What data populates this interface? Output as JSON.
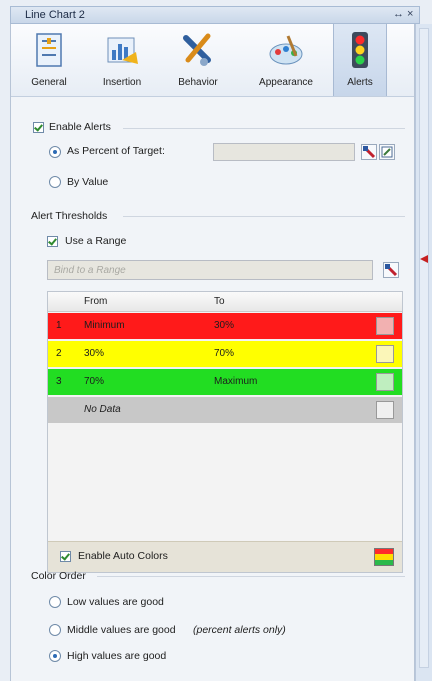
{
  "window": {
    "title": "Line Chart 2",
    "pin": "↔",
    "close": "×"
  },
  "tabs": [
    {
      "label": "General",
      "icon": "general-icon"
    },
    {
      "label": "Insertion",
      "icon": "insertion-icon"
    },
    {
      "label": "Behavior",
      "icon": "behavior-icon"
    },
    {
      "label": "Appearance",
      "icon": "appearance-icon"
    },
    {
      "label": "Alerts",
      "icon": "traffic-light-icon",
      "active": true
    }
  ],
  "alerts": {
    "enable_label": "Enable Alerts",
    "enable_checked": true,
    "percent_label": "As Percent of Target:",
    "percent_selected": true,
    "by_value_label": "By Value",
    "by_value_selected": false
  },
  "thresholds": {
    "group_label": "Alert Thresholds",
    "use_range_label": "Use a Range",
    "use_range_checked": true,
    "range_placeholder": "Bind to a Range",
    "headers": {
      "from": "From",
      "to": "To"
    },
    "rows": [
      {
        "num": "1",
        "from": "Minimum",
        "to": "30%",
        "color": "#ff1a1a"
      },
      {
        "num": "2",
        "from": "30%",
        "to": "70%",
        "color": "#ffff00"
      },
      {
        "num": "3",
        "from": "70%",
        "to": "Maximum",
        "color": "#22dd22"
      },
      {
        "num": "",
        "from": "No Data",
        "to": "",
        "color": "#c8c8c8"
      }
    ],
    "auto_colors_label": "Enable Auto Colors",
    "auto_colors_checked": true
  },
  "color_order": {
    "group_label": "Color Order",
    "options": [
      {
        "label": "Low values are good",
        "selected": false
      },
      {
        "label": "Middle values are good",
        "note": "(percent alerts only)",
        "selected": false
      },
      {
        "label": "High values are good",
        "selected": true
      }
    ]
  }
}
